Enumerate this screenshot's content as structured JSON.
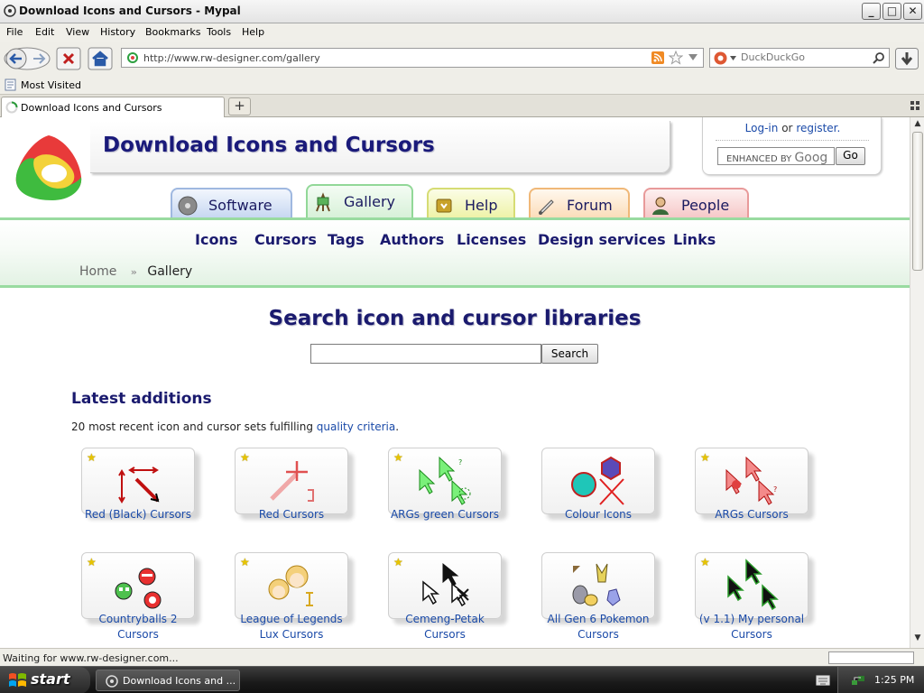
{
  "window": {
    "title": "Download Icons and Cursors - Mypal",
    "minimize": "_",
    "maximize": "□",
    "close": "✕"
  },
  "menu": [
    "File",
    "Edit",
    "View",
    "History",
    "Bookmarks",
    "Tools",
    "Help"
  ],
  "nav": {
    "url": "http://www.rw-designer.com/gallery",
    "search_placeholder": "DuckDuckGo"
  },
  "bookmarks": {
    "most_visited": "Most Visited"
  },
  "tabs": {
    "active_title": "Download Icons and Cursors",
    "new_tab": "+"
  },
  "site": {
    "title": "Download Icons and Cursors",
    "login": "Log-in",
    "or": "or",
    "register": "register.",
    "search_enhanced": "ENHANCED BY",
    "search_brand": "Goog",
    "go": "Go",
    "tabs": [
      "Software",
      "Gallery",
      "Help",
      "Forum",
      "People"
    ],
    "nav_links": [
      "Icons",
      "Cursors",
      "Tags",
      "Authors",
      "Licenses",
      "Design services",
      "Links"
    ],
    "breadcrumb": {
      "home": "Home",
      "current": "Gallery"
    },
    "search_title": "Search icon and cursor libraries",
    "search_button": "Search",
    "latest_title": "Latest additions",
    "latest_desc_pre": "20 most recent icon and cursor sets fulfilling ",
    "latest_desc_link": "quality criteria",
    "latest_desc_post": ".",
    "cards": [
      {
        "line1": "Red (Black) Cursors",
        "line2": ""
      },
      {
        "line1": "Red Cursors",
        "line2": ""
      },
      {
        "line1": "ARGs green Cursors",
        "line2": ""
      },
      {
        "line1": "Colour Icons",
        "line2": ""
      },
      {
        "line1": "ARGs Cursors",
        "line2": ""
      },
      {
        "line1": "Countryballs 2",
        "line2": "Cursors"
      },
      {
        "line1": "League of Legends",
        "line2": "Lux Cursors"
      },
      {
        "line1": "Cemeng-Petak",
        "line2": "Cursors"
      },
      {
        "line1": "All Gen 6 Pokemon",
        "line2": "Cursors"
      },
      {
        "line1": "(v 1.1) My personal",
        "line2": "Cursors"
      }
    ]
  },
  "status": {
    "text": "Waiting for www.rw-designer.com..."
  },
  "taskbar": {
    "start": "start",
    "item": "Download Icons and ...",
    "clock": "1:25 PM"
  },
  "colors": {
    "title_navy": "#1a1a6e",
    "link_blue": "#1a4aa8",
    "nav_green": "#99dba0"
  }
}
